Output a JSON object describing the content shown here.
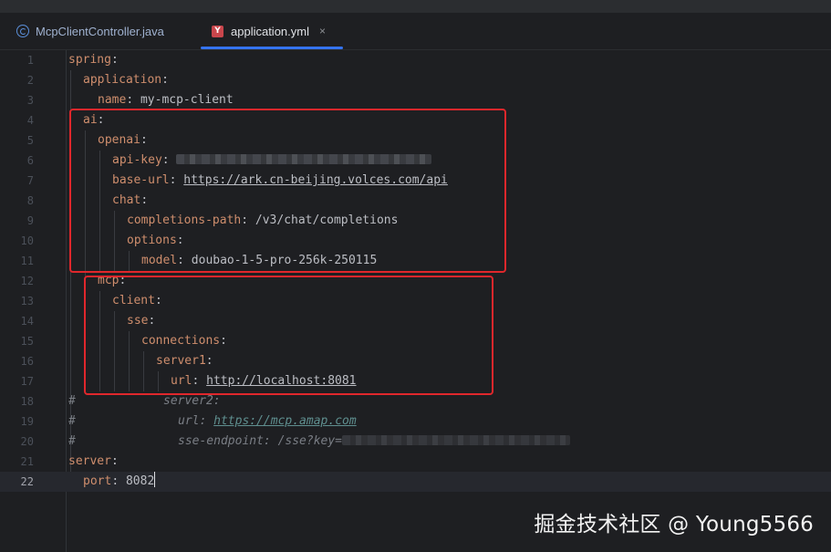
{
  "tabs": [
    {
      "label": "McpClientController.java",
      "icon": "java-class-icon"
    },
    {
      "label": "application.yml",
      "icon": "yaml-file-icon",
      "close": "×"
    }
  ],
  "lines": {
    "l1": {
      "n": "1",
      "key": "spring",
      "punct": ":"
    },
    "l2": {
      "n": "2",
      "key": "application",
      "punct": ":"
    },
    "l3": {
      "n": "3",
      "key": "name",
      "punct": ": ",
      "value": "my-mcp-client"
    },
    "l4": {
      "n": "4",
      "key": "ai",
      "punct": ":"
    },
    "l5": {
      "n": "5",
      "key": "openai",
      "punct": ":"
    },
    "l6": {
      "n": "6",
      "key": "api-key",
      "punct": ":"
    },
    "l7": {
      "n": "7",
      "key": "base-url",
      "punct": ": ",
      "value": "https://ark.cn-beijing.volces.com/api"
    },
    "l8": {
      "n": "8",
      "key": "chat",
      "punct": ":"
    },
    "l9": {
      "n": "9",
      "key": "completions-path",
      "punct": ": ",
      "value": "/v3/chat/completions"
    },
    "l10": {
      "n": "10",
      "key": "options",
      "punct": ":"
    },
    "l11": {
      "n": "11",
      "key": "model",
      "punct": ": ",
      "value": "doubao-1-5-pro-256k-250115"
    },
    "l12": {
      "n": "12",
      "key": "mcp",
      "punct": ":"
    },
    "l13": {
      "n": "13",
      "key": "client",
      "punct": ":"
    },
    "l14": {
      "n": "14",
      "key": "sse",
      "punct": ":"
    },
    "l15": {
      "n": "15",
      "key": "connections",
      "punct": ":"
    },
    "l16": {
      "n": "16",
      "key": "server1",
      "punct": ":"
    },
    "l17": {
      "n": "17",
      "key": "url",
      "punct": ": ",
      "value": "http://localhost:8081"
    },
    "l18": {
      "n": "18",
      "hash": "#",
      "comment": "server2:"
    },
    "l19": {
      "n": "19",
      "hash": "#",
      "comment": "url: ",
      "value": "https://mcp.amap.com"
    },
    "l20": {
      "n": "20",
      "hash": "#",
      "comment": "sse-endpoint: /sse?key="
    },
    "l21": {
      "n": "21",
      "key": "server",
      "punct": ":"
    },
    "l22": {
      "n": "22",
      "key": "port",
      "punct": ": ",
      "value": "8082"
    }
  },
  "watermark": "掘金技术社区 @ Young5566",
  "colors": {
    "highlight_box": "#e0272c",
    "active_tab_underline": "#3574f0",
    "yaml_key": "#cf8e6d"
  }
}
